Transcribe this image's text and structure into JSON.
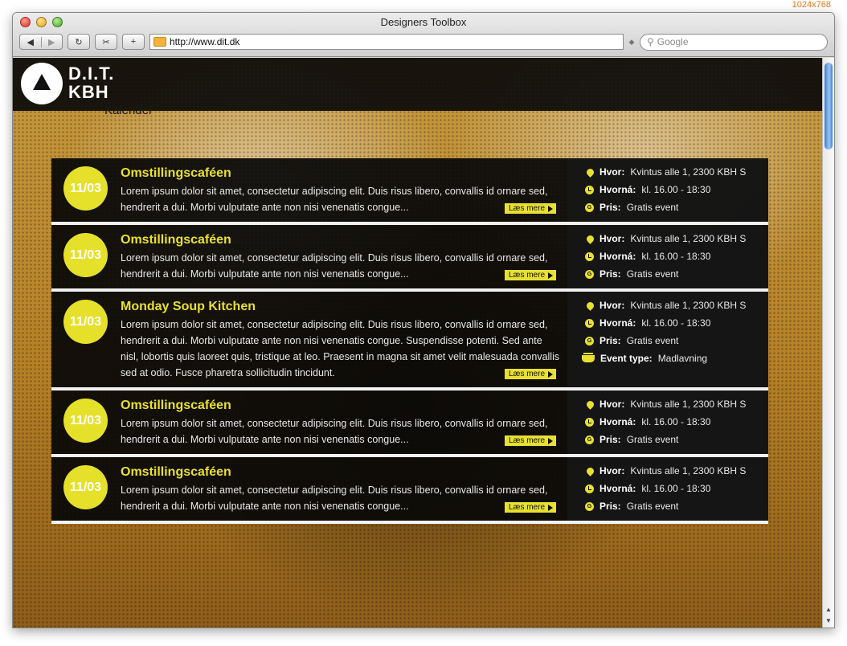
{
  "screen_note": "1024x768",
  "browser": {
    "window_title": "Designers Toolbox",
    "back_label": "◀",
    "forward_label": "▶",
    "reload_label": "↻",
    "snip_label": "✂",
    "add_label": "+",
    "url": "http://www.dit.dk",
    "search_placeholder": "Google"
  },
  "site": {
    "logo_line1": "D.I.T.",
    "logo_line2": "KBH",
    "section_label": "Kalender"
  },
  "labels": {
    "read_more": "Læs mere",
    "where": "Hvor:",
    "when": "Hvorná:",
    "price": "Pris:",
    "event_type": "Event type:"
  },
  "events": [
    {
      "date": "11/03",
      "title": "Omstillingscaféen",
      "description": "Lorem ipsum dolor sit amet, consectetur adipiscing elit. Duis risus libero, convallis id ornare sed, hendrerit a dui. Morbi vulputate ante non nisi venenatis congue...",
      "where": "Kvintus alle 1, 2300 KBH S",
      "when": "kl. 16.00 - 18:30",
      "price": "Gratis event"
    },
    {
      "date": "11/03",
      "title": "Omstillingscaféen",
      "description": "Lorem ipsum dolor sit amet, consectetur adipiscing elit. Duis risus libero, convallis id ornare sed, hendrerit a dui. Morbi vulputate ante non nisi venenatis congue...",
      "where": "Kvintus alle 1, 2300 KBH S",
      "when": "kl. 16.00 - 18:30",
      "price": "Gratis event"
    },
    {
      "date": "11/03",
      "title": "Monday Soup Kitchen",
      "description": "Lorem ipsum dolor sit amet, consectetur adipiscing elit. Duis risus libero, convallis id ornare sed, hendrerit a dui. Morbi vulputate ante non nisi venenatis congue. Suspendisse potenti. Sed ante nisl, lobortis quis laoreet quis, tristique at leo. Praesent in magna sit amet velit malesuada convallis sed at odio. Fusce pharetra sollicitudin tincidunt.",
      "where": "Kvintus alle 1, 2300 KBH S",
      "when": "kl. 16.00 - 18:30",
      "price": "Gratis event",
      "event_type": "Madlavning"
    },
    {
      "date": "11/03",
      "title": "Omstillingscaféen",
      "description": "Lorem ipsum dolor sit amet, consectetur adipiscing elit. Duis risus libero, convallis id ornare sed, hendrerit a dui. Morbi vulputate ante non nisi venenatis congue...",
      "where": "Kvintus alle 1, 2300 KBH S",
      "when": "kl. 16.00 - 18:30",
      "price": "Gratis event"
    },
    {
      "date": "11/03",
      "title": "Omstillingscaféen",
      "description": "Lorem ipsum dolor sit amet, consectetur adipiscing elit. Duis risus libero, convallis id ornare sed, hendrerit a dui. Morbi vulputate ante non nisi venenatis congue...",
      "where": "Kvintus alle 1, 2300 KBH S",
      "when": "kl. 16.00 - 18:30",
      "price": "Gratis event"
    }
  ]
}
